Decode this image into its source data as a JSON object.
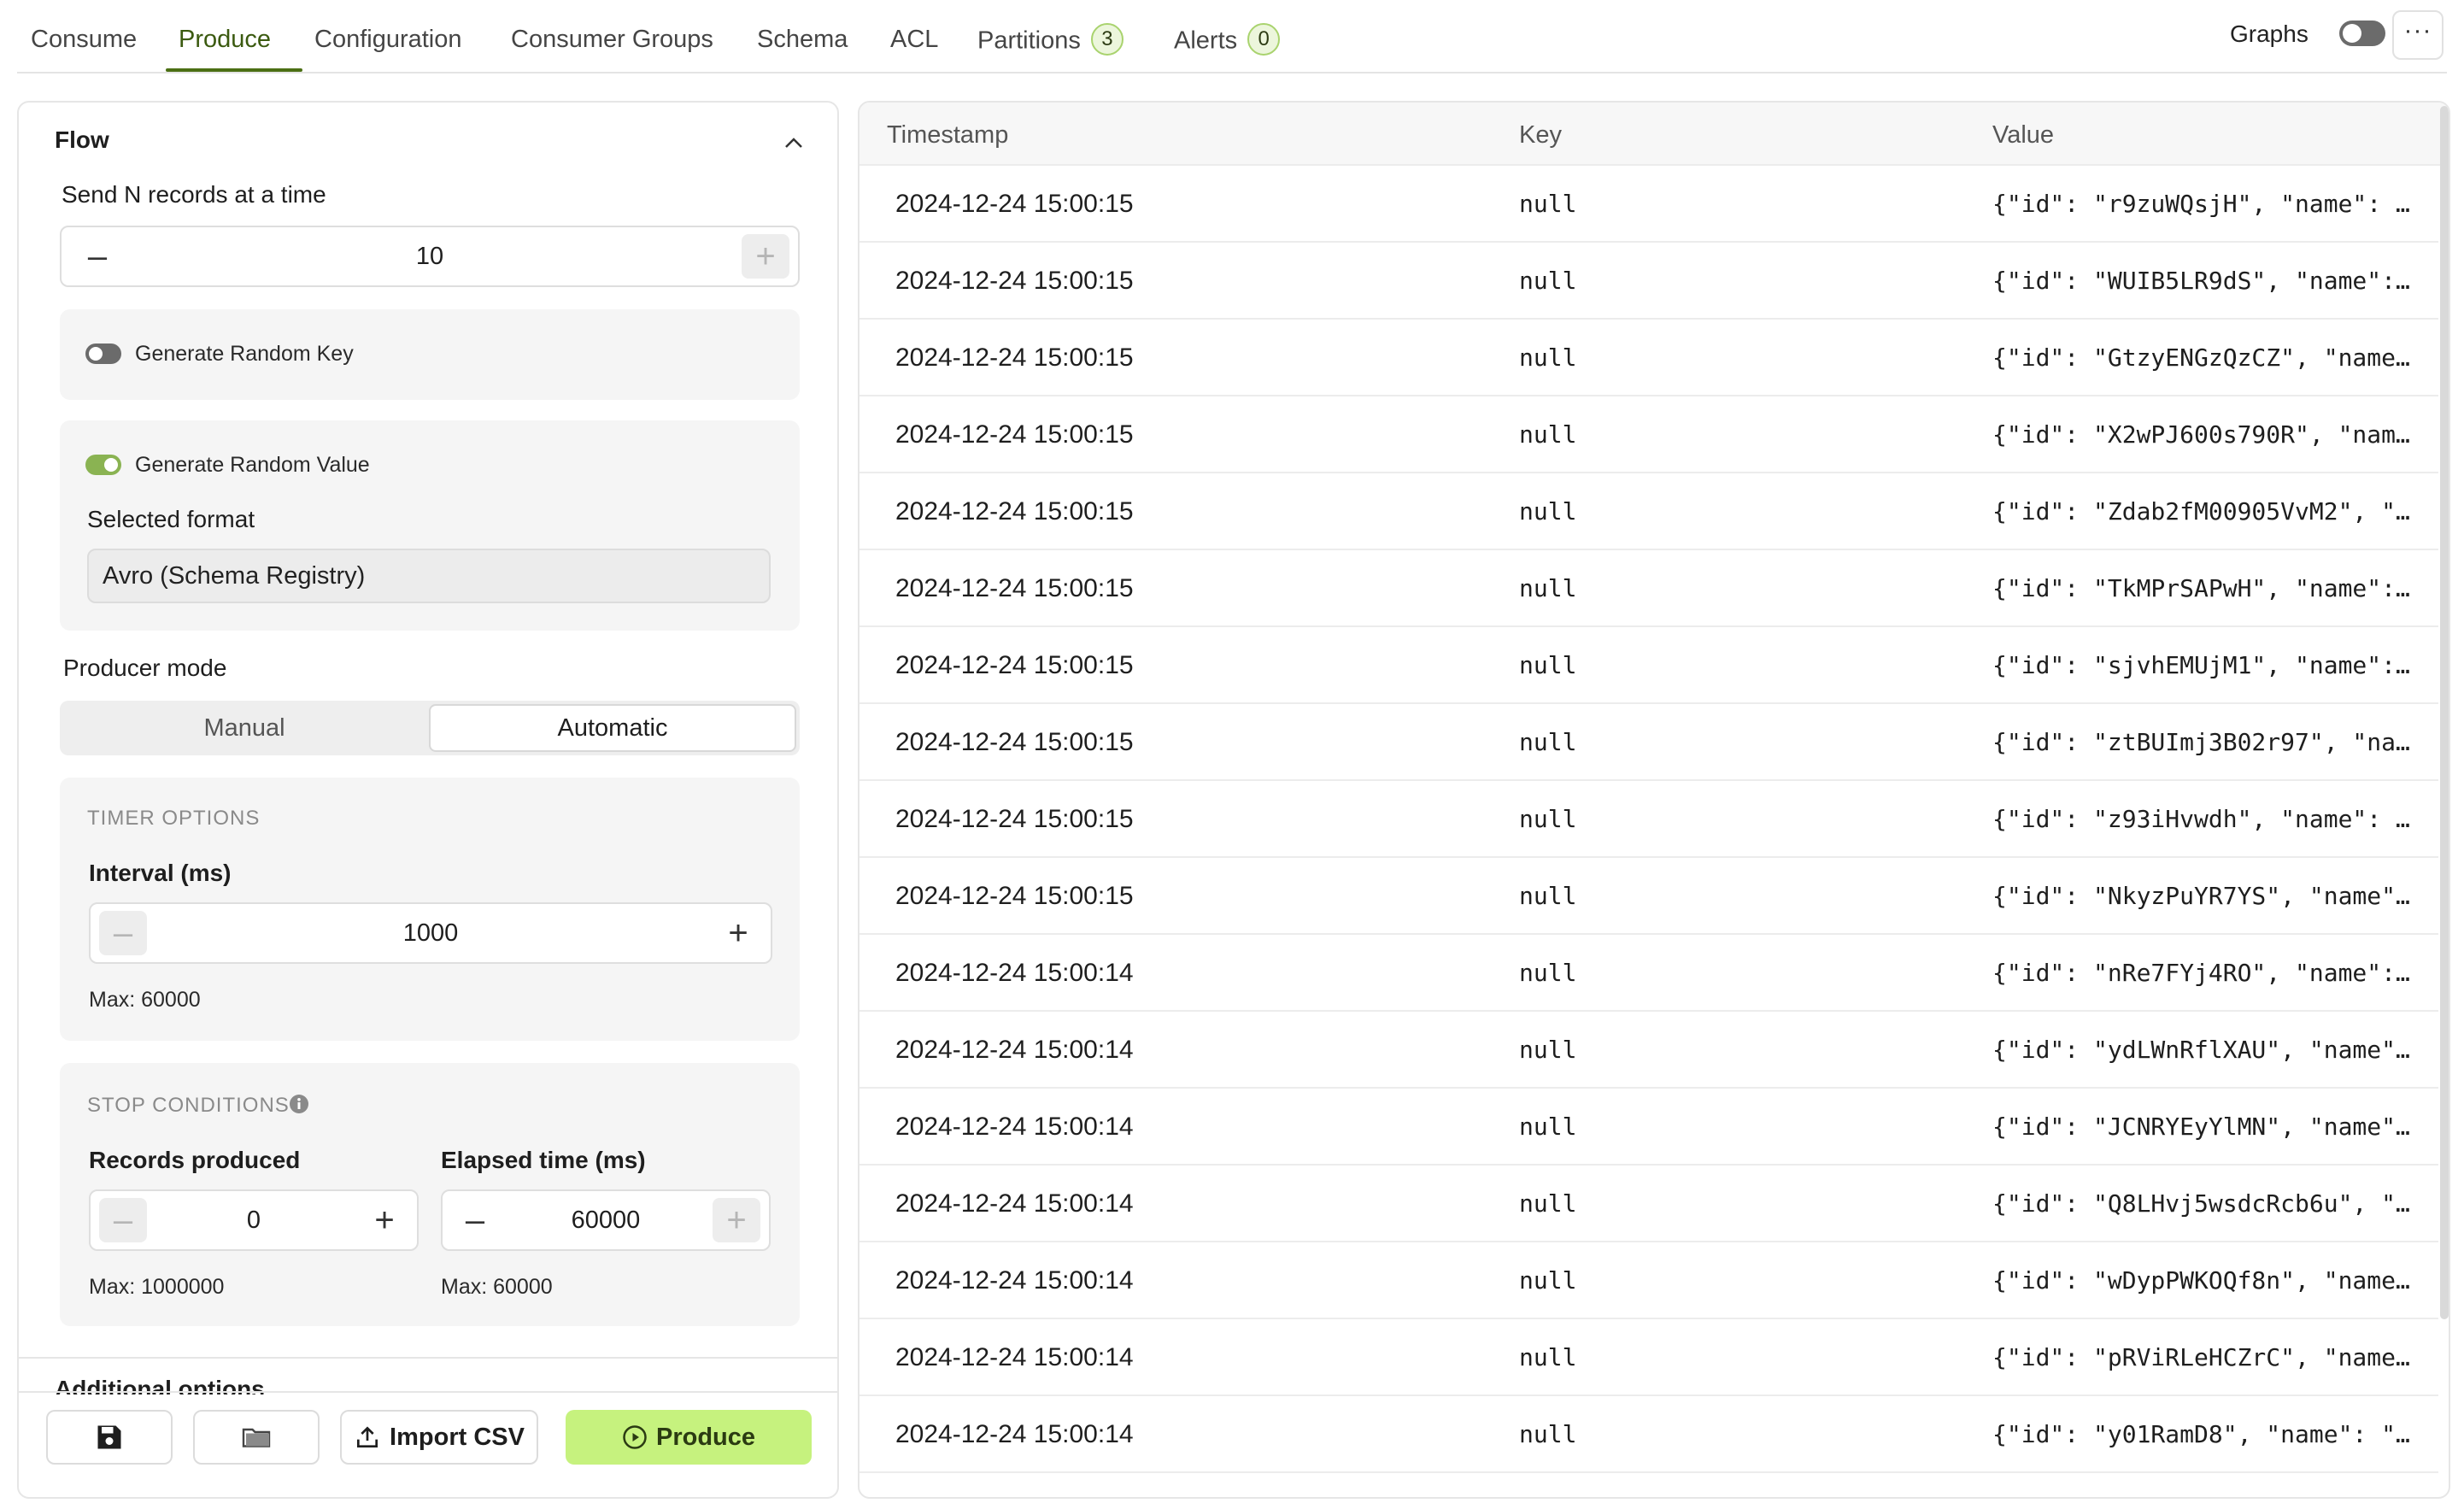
{
  "tabs": [
    {
      "label": "Consume"
    },
    {
      "label": "Produce",
      "active": true
    },
    {
      "label": "Configuration"
    },
    {
      "label": "Consumer Groups"
    },
    {
      "label": "Schema"
    },
    {
      "label": "ACL"
    },
    {
      "label": "Partitions",
      "badge": "3"
    },
    {
      "label": "Alerts",
      "badge": "0"
    }
  ],
  "header": {
    "graphs_label": "Graphs",
    "graphs_enabled": false,
    "more_label": "···"
  },
  "flow": {
    "title": "Flow",
    "send_n_label": "Send N records at a time",
    "send_n_value": "10",
    "random_key_label": "Generate Random Key",
    "random_key_enabled": false,
    "random_value_label": "Generate Random Value",
    "random_value_enabled": true,
    "selected_format_label": "Selected format",
    "selected_format_value": "Avro (Schema Registry)",
    "producer_mode_label": "Producer mode",
    "mode_manual": "Manual",
    "mode_automatic": "Automatic",
    "mode_selected": "Automatic",
    "timer_options_caption": "TIMER OPTIONS",
    "interval_label": "Interval (ms)",
    "interval_value": "1000",
    "interval_max": "Max: 60000",
    "stop_conditions_caption": "STOP CONDITIONS",
    "records_produced_label": "Records produced",
    "records_produced_value": "0",
    "records_produced_max": "Max: 1000000",
    "elapsed_time_label": "Elapsed time (ms)",
    "elapsed_time_value": "60000",
    "elapsed_time_max": "Max: 60000",
    "next_section_label": "Additional options"
  },
  "footer": {
    "import_csv_label": "Import CSV",
    "produce_label": "Produce"
  },
  "colors": {
    "accent": "#4b6f14",
    "produce_button": "#c6f27e",
    "toggle_on": "#8ab352",
    "toggle_off": "#6b6b6b"
  },
  "table": {
    "columns": [
      "Timestamp",
      "Key",
      "Value"
    ],
    "rows": [
      {
        "timestamp": "2024-12-24 15:00:15",
        "key": "null",
        "value": "{\"id\": \"r9zuWQsjH\", \"name\": …"
      },
      {
        "timestamp": "2024-12-24 15:00:15",
        "key": "null",
        "value": "{\"id\": \"WUIB5LR9dS\", \"name\":…"
      },
      {
        "timestamp": "2024-12-24 15:00:15",
        "key": "null",
        "value": "{\"id\": \"GtzyENGzQzCZ\", \"name…"
      },
      {
        "timestamp": "2024-12-24 15:00:15",
        "key": "null",
        "value": "{\"id\": \"X2wPJ600s790R\", \"nam…"
      },
      {
        "timestamp": "2024-12-24 15:00:15",
        "key": "null",
        "value": "{\"id\": \"Zdab2fM00905VvM2\", \"…"
      },
      {
        "timestamp": "2024-12-24 15:00:15",
        "key": "null",
        "value": "{\"id\": \"TkMPrSAPwH\", \"name\":…"
      },
      {
        "timestamp": "2024-12-24 15:00:15",
        "key": "null",
        "value": "{\"id\": \"sjvhEMUjM1\", \"name\":…"
      },
      {
        "timestamp": "2024-12-24 15:00:15",
        "key": "null",
        "value": "{\"id\": \"ztBUImj3B02r97\", \"na…"
      },
      {
        "timestamp": "2024-12-24 15:00:15",
        "key": "null",
        "value": "{\"id\": \"z93iHvwdh\", \"name\": …"
      },
      {
        "timestamp": "2024-12-24 15:00:15",
        "key": "null",
        "value": "{\"id\": \"NkyzPuYR7YS\", \"name\"…"
      },
      {
        "timestamp": "2024-12-24 15:00:14",
        "key": "null",
        "value": "{\"id\": \"nRe7FYj4RO\", \"name\":…"
      },
      {
        "timestamp": "2024-12-24 15:00:14",
        "key": "null",
        "value": "{\"id\": \"ydLWnRflXAU\", \"name\"…"
      },
      {
        "timestamp": "2024-12-24 15:00:14",
        "key": "null",
        "value": "{\"id\": \"JCNRYEyYlMN\", \"name\"…"
      },
      {
        "timestamp": "2024-12-24 15:00:14",
        "key": "null",
        "value": "{\"id\": \"Q8LHvj5wsdcRcb6u\", \"…"
      },
      {
        "timestamp": "2024-12-24 15:00:14",
        "key": "null",
        "value": "{\"id\": \"wDypPWKOQf8n\", \"name…"
      },
      {
        "timestamp": "2024-12-24 15:00:14",
        "key": "null",
        "value": "{\"id\": \"pRViRLeHCZrC\", \"name…"
      },
      {
        "timestamp": "2024-12-24 15:00:14",
        "key": "null",
        "value": "{\"id\": \"y01RamD8\", \"name\": \"…"
      }
    ]
  }
}
